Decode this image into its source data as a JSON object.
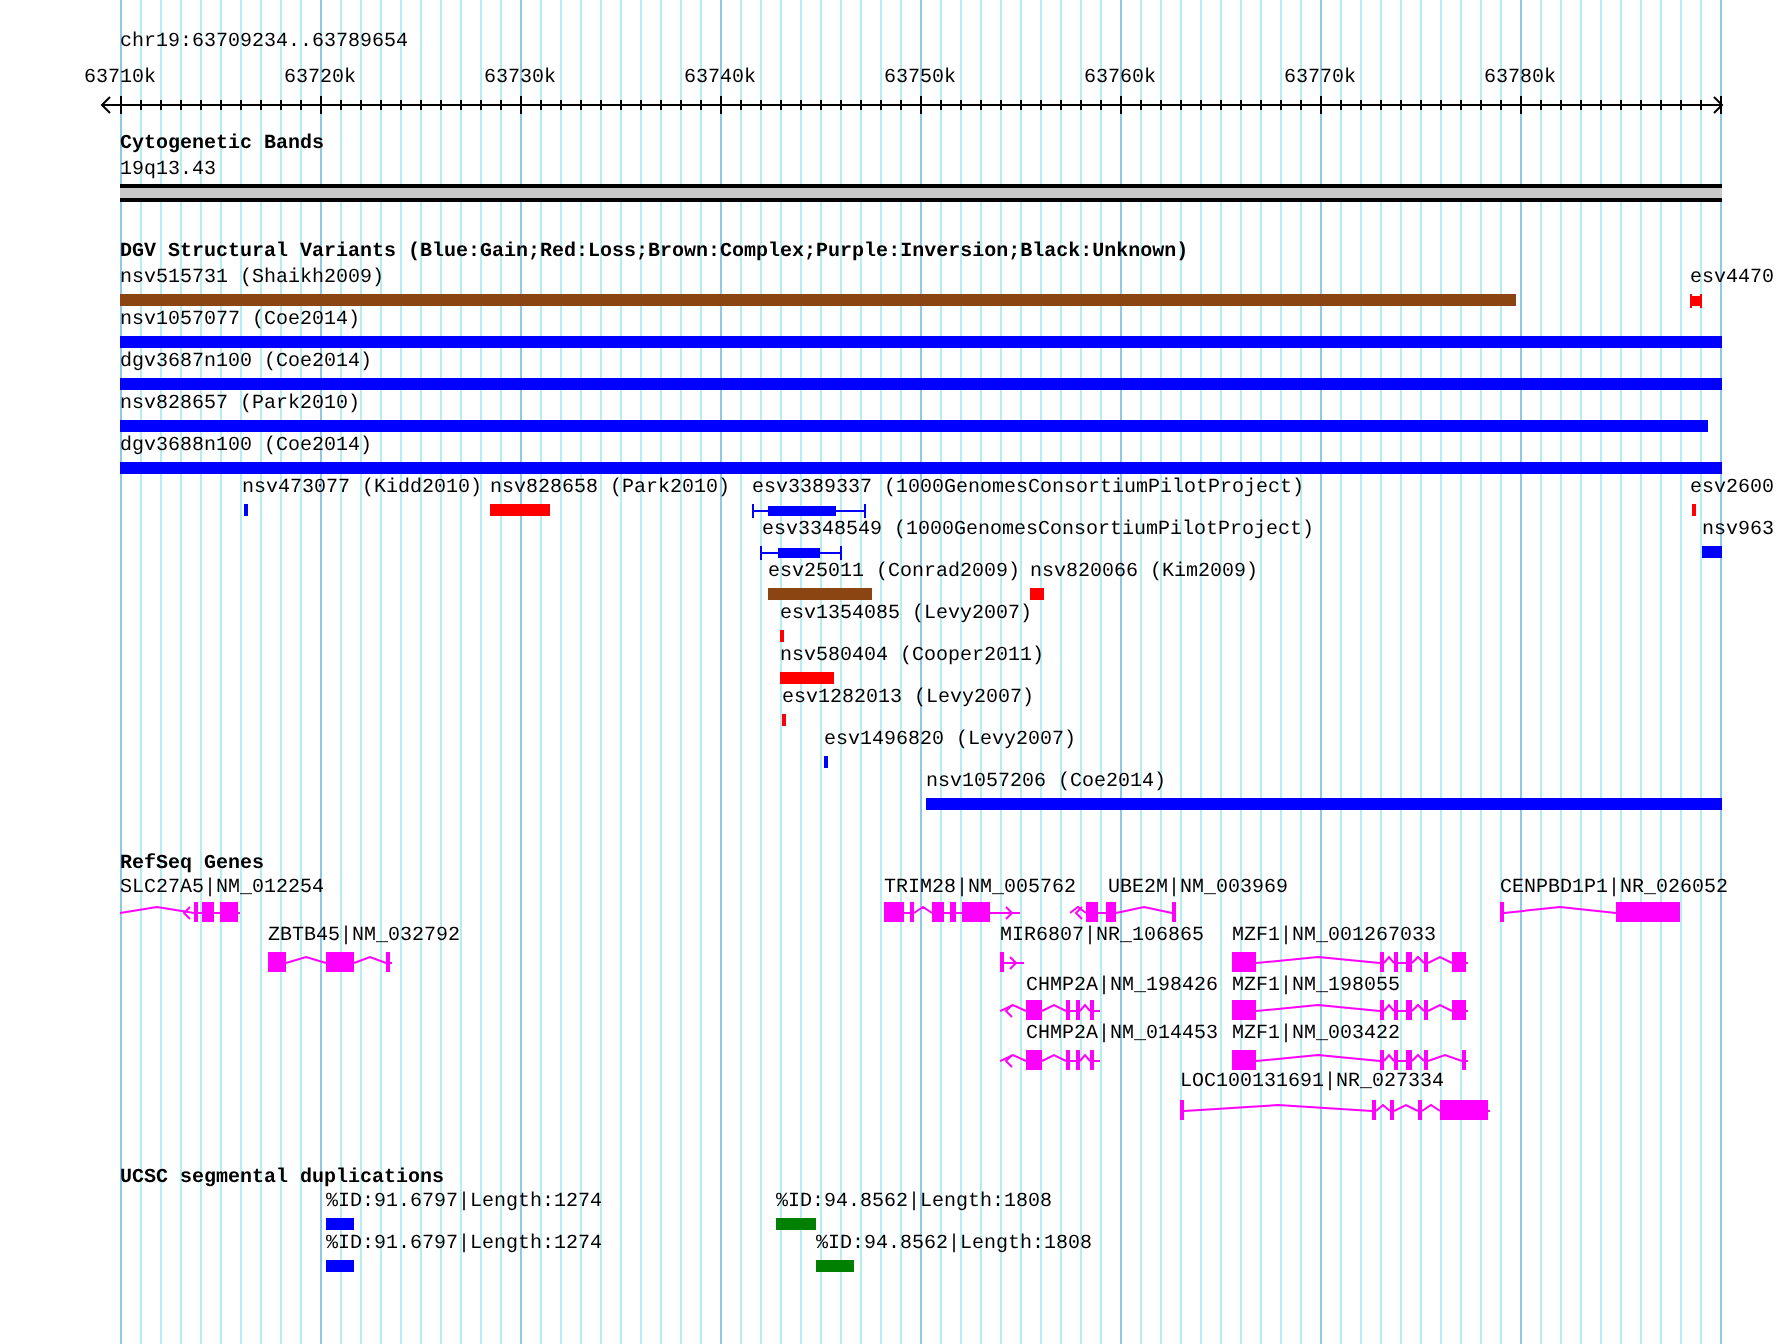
{
  "ruler": {
    "location": "chr19:63709234..63789654",
    "ticks": [
      "63710k",
      "63720k",
      "63730k",
      "63740k",
      "63750k",
      "63760k",
      "63770k",
      "63780k"
    ]
  },
  "cytogenetic_bands": {
    "title": "Cytogenetic Bands",
    "band": "19q13.43"
  },
  "dgv": {
    "title": "DGV Structural Variants (Blue:Gain;Red:Loss;Brown:Complex;Purple:Inversion;Black:Unknown)",
    "features": [
      {
        "label": "nsv515731 (Shaikh2009)",
        "color": "#8b4513",
        "kind": "bar"
      },
      {
        "label": "esv4470",
        "color": "#ff0000",
        "kind": "bracketed"
      },
      {
        "label": "nsv1057077 (Coe2014)",
        "color": "#0000ff",
        "kind": "bar"
      },
      {
        "label": "dgv3687n100 (Coe2014)",
        "color": "#0000ff",
        "kind": "bar"
      },
      {
        "label": "nsv828657 (Park2010)",
        "color": "#0000ff",
        "kind": "bar"
      },
      {
        "label": "dgv3688n100 (Coe2014)",
        "color": "#0000ff",
        "kind": "bar"
      },
      {
        "label": "nsv473077 (Kidd2010)",
        "color": "#0000ff",
        "kind": "bar"
      },
      {
        "label": "nsv828658 (Park2010)",
        "color": "#ff0000",
        "kind": "bar"
      },
      {
        "label": "esv3389337 (1000GenomesConsortiumPilotProject)",
        "color": "#0000ff",
        "kind": "bracketed"
      },
      {
        "label": "esv2600",
        "color": "#ff0000",
        "kind": "bar"
      },
      {
        "label": "esv3348549 (1000GenomesConsortiumPilotProject)",
        "color": "#0000ff",
        "kind": "bracketed"
      },
      {
        "label": "nsv963",
        "color": "#0000ff",
        "kind": "bar"
      },
      {
        "label": "esv25011 (Conrad2009)",
        "color": "#8b4513",
        "kind": "bar"
      },
      {
        "label": "nsv820066 (Kim2009)",
        "color": "#ff0000",
        "kind": "bar"
      },
      {
        "label": "esv1354085 (Levy2007)",
        "color": "#ff0000",
        "kind": "bar"
      },
      {
        "label": "nsv580404 (Cooper2011)",
        "color": "#ff0000",
        "kind": "bar"
      },
      {
        "label": "esv1282013 (Levy2007)",
        "color": "#ff0000",
        "kind": "bar"
      },
      {
        "label": "esv1496820 (Levy2007)",
        "color": "#0000ff",
        "kind": "bar"
      },
      {
        "label": "nsv1057206 (Coe2014)",
        "color": "#0000ff",
        "kind": "bar"
      }
    ]
  },
  "refseq": {
    "title": "RefSeq Genes",
    "genes": [
      {
        "label": "SLC27A5|NM_012254",
        "reverse_strand": true
      },
      {
        "label": "TRIM28|NM_005762",
        "reverse_strand": false
      },
      {
        "label": "UBE2M|NM_003969",
        "reverse_strand": true
      },
      {
        "label": "CENPBD1P1|NR_026052"
      },
      {
        "label": "ZBTB45|NM_032792"
      },
      {
        "label": "MIR6807|NR_106865",
        "reverse_strand": false
      },
      {
        "label": "MZF1|NM_001267033"
      },
      {
        "label": "CHMP2A|NM_198426",
        "reverse_strand": true
      },
      {
        "label": "MZF1|NM_198055"
      },
      {
        "label": "CHMP2A|NM_014453",
        "reverse_strand": true
      },
      {
        "label": "MZF1|NM_003422"
      },
      {
        "label": "LOC100131691|NR_027334"
      }
    ]
  },
  "segmental_duplications": {
    "title": "UCSC segmental duplications",
    "features": [
      {
        "label": "%ID:91.6797|Length:1274",
        "color": "#0000ff"
      },
      {
        "label": "%ID:94.8562|Length:1808",
        "color": "#008000"
      },
      {
        "label": "%ID:91.6797|Length:1274",
        "color": "#0000ff"
      },
      {
        "label": "%ID:94.8562|Length:1808",
        "color": "#008000"
      }
    ]
  }
}
